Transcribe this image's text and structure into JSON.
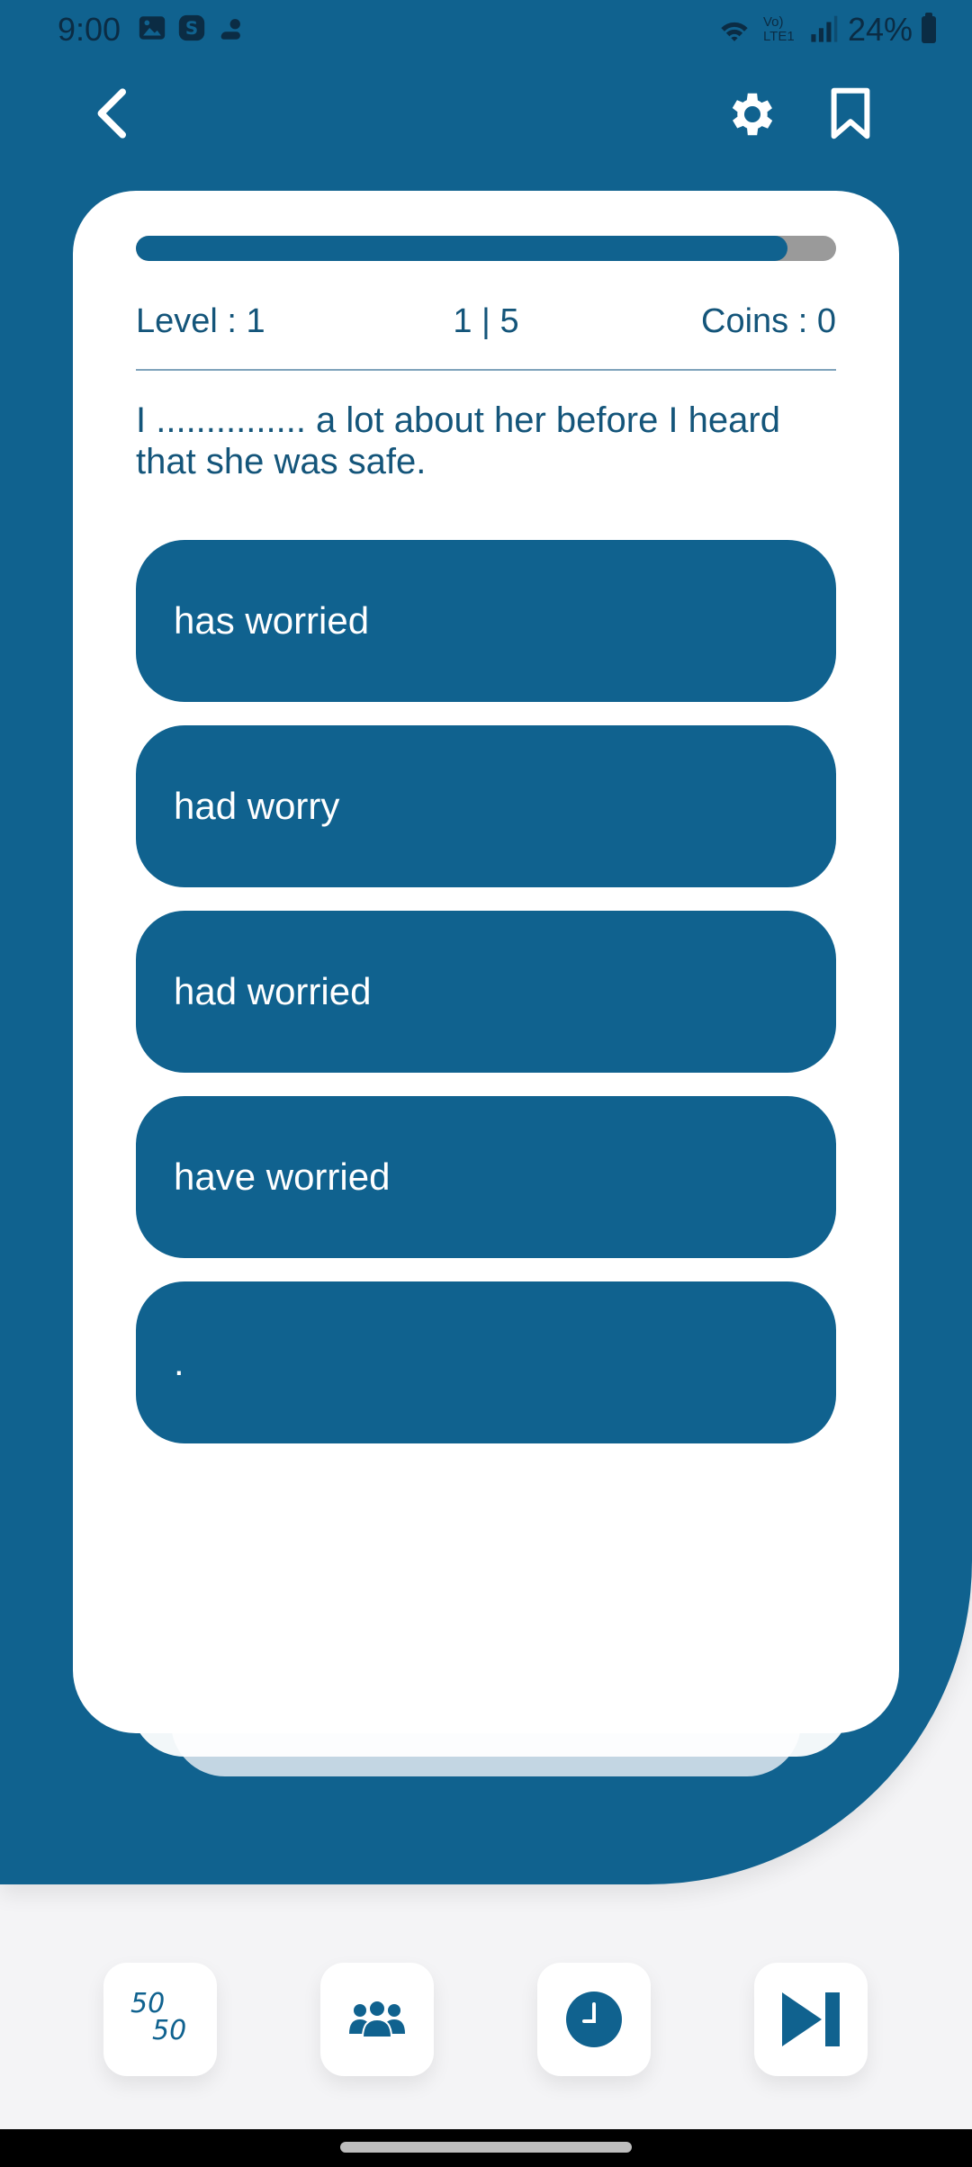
{
  "status_bar": {
    "time": "9:00",
    "network": "Vo) LTE1",
    "battery": "24%"
  },
  "header": {
    "back_icon": "chevron-left-icon",
    "settings_icon": "gear-icon",
    "bookmark_icon": "bookmark-icon"
  },
  "quiz": {
    "progress_fraction": 0.93,
    "level": "Level : 1",
    "counter": "1 | 5",
    "coins": "Coins : 0",
    "question": "I ............... a lot about her before I heard that she was safe.",
    "options": [
      "has worried",
      "had worry",
      "had worried",
      "have worried",
      "."
    ]
  },
  "lifelines": {
    "fifty_a": "50",
    "fifty_b": "50",
    "audience_icon": "people-group-icon",
    "timer_icon": "clock-icon",
    "skip_icon": "skip-next-icon"
  },
  "colors": {
    "primary": "#10628f",
    "text": "#14557a",
    "progress_track": "#9a9a9a"
  }
}
